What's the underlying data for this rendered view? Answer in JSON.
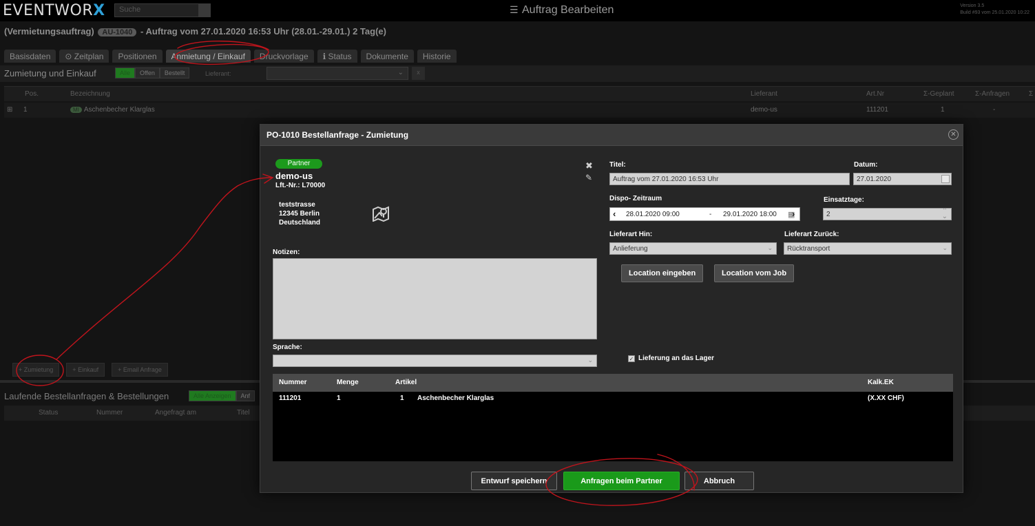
{
  "topbar": {
    "logo_text": "EVENTWOR",
    "logo_accent": "X",
    "search_placeholder": "Suche",
    "title": "Auftrag Bearbeiten",
    "version": "Version 3.5",
    "build": "Build #93 vom 25.01.2020 10:22"
  },
  "order": {
    "type": "(Vermietungsauftrag)",
    "number": "AU-1040",
    "text": "- Auftrag vom 27.01.2020 16:53 Uhr (28.01.-29.01.) 2 Tag(e)"
  },
  "tabs": [
    {
      "label": "Basisdaten"
    },
    {
      "label": "⊙ Zeitplan"
    },
    {
      "label": "Positionen"
    },
    {
      "label": "Anmietung / Einkauf"
    },
    {
      "label": "Druckvorlage"
    },
    {
      "label": "ℹ Status"
    },
    {
      "label": "Dokumente"
    },
    {
      "label": "Historie"
    }
  ],
  "section": {
    "title": "Zumietung und Einkauf",
    "filters": [
      "Alle",
      "Offen",
      "Bestellt"
    ],
    "lieferant_label": "Lieferant:",
    "clear": "x"
  },
  "table": {
    "headers": [
      "Pos.",
      "Bezeichnung",
      "Lieferant",
      "Art.Nr",
      "Σ-Geplant",
      "Σ-Anfragen",
      "Σ"
    ],
    "row": {
      "pos": "1",
      "badge": "MI",
      "name": "Aschenbecher Klarglas",
      "lieferant": "demo-us",
      "artnr": "111201",
      "geplant": "1",
      "anfragen": "-"
    }
  },
  "bottom_buttons": [
    "Zumietung",
    "Einkauf",
    "Email Anfrage"
  ],
  "lower": {
    "title": "Laufende Bestellanfragen & Bestellungen",
    "filters": [
      "Alle Anzeigen",
      "Anf"
    ],
    "headers": [
      "Status",
      "Nummer",
      "Angefragt am",
      "Titel"
    ]
  },
  "modal": {
    "title": "PO-1010 Bestellanfrage - Zumietung",
    "partner_badge": "Partner",
    "partner_name": "demo-us",
    "partner_nr": "Lft.-Nr.: L70000",
    "address": [
      "teststrasse",
      "12345 Berlin",
      "Deutschland"
    ],
    "notizen_label": "Notizen:",
    "sprache_label": "Sprache:",
    "titel_label": "Titel:",
    "titel_value": "Auftrag vom 27.01.2020 16:53 Uhr",
    "datum_label": "Datum:",
    "datum_value": "27.01.2020",
    "dispo_label": "Dispo- Zeitraum",
    "dispo_from": "28.01.2020 09:00",
    "dispo_sep": "-",
    "dispo_to": "29.01.2020 18:00",
    "einsatz_label": "Einsatztage:",
    "einsatz_value": "2",
    "hin_label": "Lieferart Hin:",
    "hin_value": "Anlieferung",
    "zurueck_label": "Lieferart Zurück:",
    "zurueck_value": "Rücktransport",
    "location_btn": "Location eingeben",
    "location_job_btn": "Location vom Job",
    "lager_label": "Lieferung an das Lager",
    "items_headers": [
      "Nummer",
      "Menge",
      "Artikel",
      "Kalk.EK"
    ],
    "item": {
      "nummer": "111201",
      "menge": "1",
      "qty": "1",
      "artikel": "Aschenbecher Klarglas",
      "ek": "(X.XX CHF)"
    },
    "btn_draft": "Entwurf speichern",
    "btn_request": "Anfragen beim Partner",
    "btn_cancel": "Abbruch"
  },
  "colors": {
    "accent_blue": "#2ea0d8",
    "partner_green": "#1c9a1c",
    "annotation_red": "#c0141c"
  }
}
